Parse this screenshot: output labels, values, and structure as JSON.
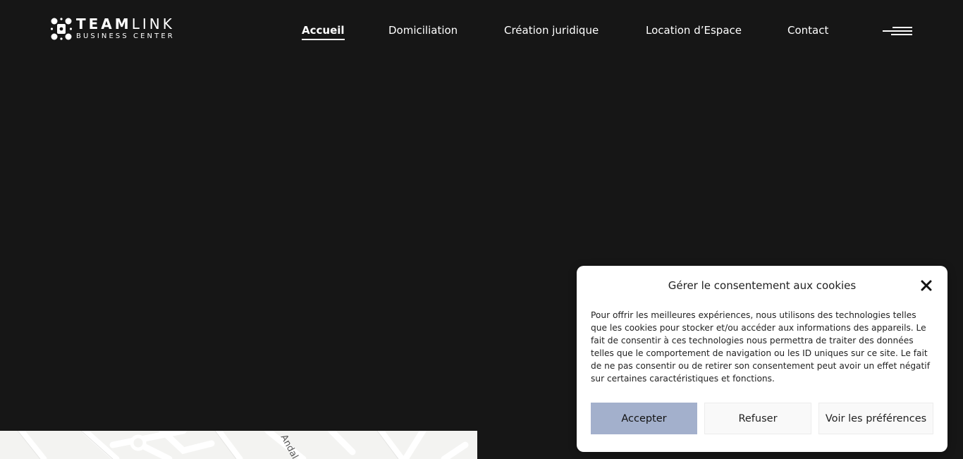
{
  "brand": {
    "name_bold": "TEAM",
    "name_light": "LINK",
    "tagline": "BUSINESS CENTER"
  },
  "nav": {
    "items": [
      {
        "label": "Accueil",
        "active": true
      },
      {
        "label": "Domiciliation",
        "active": false
      },
      {
        "label": "Création juridique",
        "active": false
      },
      {
        "label": "Location d’Espace",
        "active": false
      },
      {
        "label": "Contact",
        "active": false
      }
    ],
    "menu_icon": "hamburger-icon"
  },
  "map": {
    "street_label": "Andal"
  },
  "cookie": {
    "title": "Gérer le consentement aux cookies",
    "close_icon": "close-icon",
    "body": "Pour offrir les meilleures expériences, nous utilisons des technologies telles que les cookies pour stocker et/ou accéder aux informations des appareils. Le fait de consentir à ces technologies nous permettra de traiter des données telles que le comportement de navigation ou les ID uniques sur ce site. Le fait de ne pas consentir ou de retirer son consentement peut avoir un effet négatif sur certaines caractéristiques et fonctions.",
    "accept_label": "Accepter",
    "refuse_label": "Refuser",
    "preferences_label": "Voir les préférences"
  },
  "colors": {
    "background": "#161616",
    "accept_button": "#a3b0cc",
    "text": "#ffffff"
  }
}
